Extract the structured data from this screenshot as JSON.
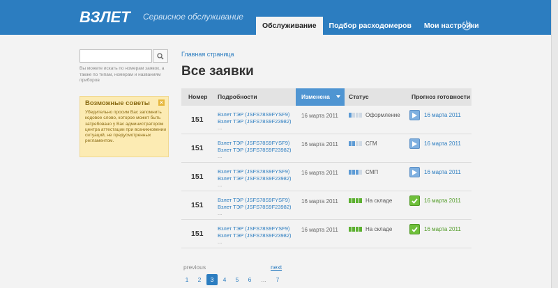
{
  "header": {
    "logo_text": "ВЗЛЕТ",
    "tagline": "Сервисное обслуживание",
    "tabs": [
      {
        "label": "Обслуживание",
        "active": true
      },
      {
        "label": "Подбор расходомеров",
        "active": false
      },
      {
        "label": "Мои настройки",
        "active": false
      }
    ],
    "power_icon": "power-icon"
  },
  "search": {
    "placeholder": "",
    "value": "",
    "hint": "Вы можете искать по номерам заявок, а также по типам, номерам и названиям приборов"
  },
  "tips": {
    "title": "Возможные советы",
    "close": "×",
    "text": "Убедительно просим Вас запомнить кодовое слово, которое может быть затребовано у Вас администратором центра аттестации при возникновении ситуаций, не предусмотренных регламентом."
  },
  "breadcrumb": "Главная страница",
  "title": "Все заявки",
  "table": {
    "headers": {
      "number": "Номер",
      "details": "Подробности",
      "changed": "Изменена",
      "status": "Статус",
      "forecast": "Прогноз готовности"
    },
    "rows": [
      {
        "number": "151",
        "link1": "Взлет ТЭР (JSFS78S9FYSF9)",
        "link2": "Взлет ТЭР (JSFS78S9F23982)",
        "more": "...",
        "date": "16 марта 2011",
        "status": "Оформление",
        "forecast": "16 марта 2011"
      },
      {
        "number": "151",
        "link1": "Взлет ТЭР (JSFS78S9FYSF9)",
        "link2": "Взлет ТЭР (JSFS78S9F23982)",
        "more": "...",
        "date": "16 марта 2011",
        "status": "СГМ",
        "forecast": "16 марта 2011"
      },
      {
        "number": "151",
        "link1": "Взлет ТЭР (JSFS78S9FYSF9)",
        "link2": "Взлет ТЭР (JSFS78S9F23982)",
        "more": "...",
        "date": "16 марта 2011",
        "status": "СМП",
        "forecast": "16 марта 2011"
      },
      {
        "number": "151",
        "link1": "Взлет ТЭР (JSFS78S9FYSF9)",
        "link2": "Взлет ТЭР (JSFS78S9F23982)",
        "more": "...",
        "date": "16 марта 2011",
        "status": "На складе",
        "forecast": "16 марта 2011"
      },
      {
        "number": "151",
        "link1": "Взлет ТЭР (JSFS78S9FYSF9)",
        "link2": "Взлет ТЭР (JSFS78S9F23982)",
        "more": "...",
        "date": "16 марта 2011",
        "status": "На складе",
        "forecast": "16 марта 2011"
      }
    ]
  },
  "pagination": {
    "prev": "previous",
    "next": "next",
    "pages": [
      "1",
      "2",
      "3",
      "4",
      "5",
      "6",
      "...",
      "7"
    ],
    "current": "3"
  },
  "colors": {
    "header_bg": "#2c7dc0",
    "link": "#2c7dc0",
    "sorted_header": "#4f95d2",
    "tips_bg": "#fcebb3",
    "ready_green": "#4f9a24"
  }
}
